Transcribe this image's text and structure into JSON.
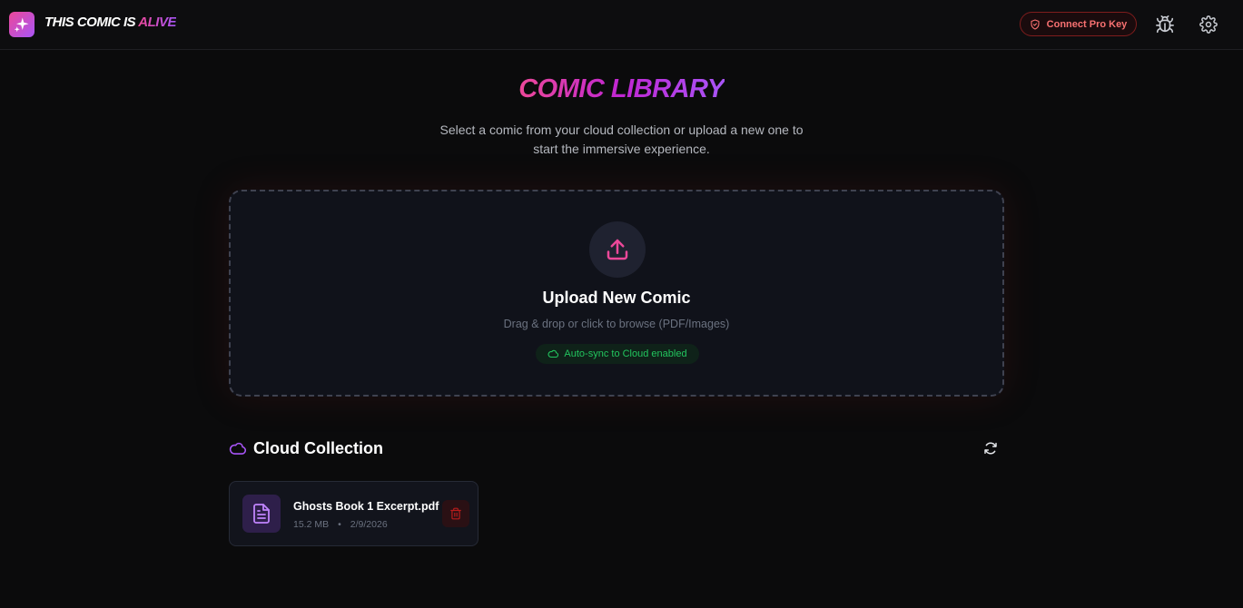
{
  "header": {
    "brand_main": "This Comic Is ",
    "brand_accent": "Alive",
    "pro_key_label": "Connect Pro Key"
  },
  "page": {
    "title": "Comic Library",
    "subtitle": "Select a comic from your cloud collection or upload a new one to start the immersive experience."
  },
  "upload": {
    "title": "Upload New Comic",
    "hint": "Drag & drop or click to browse (PDF/Images)",
    "sync_label": "Auto-sync to Cloud enabled"
  },
  "collection": {
    "title": "Cloud Collection",
    "files": [
      {
        "name": "Ghosts Book 1 Excerpt.pdf",
        "size": "15.2 MB",
        "separator": "•",
        "date": "2/9/2026"
      }
    ]
  },
  "icons": {
    "logo": "sparkles-icon",
    "pro_key": "shield-icon",
    "debug": "bug-icon",
    "settings": "gear-icon",
    "upload": "upload-icon",
    "sync": "cloud-icon",
    "collection": "cloud-icon",
    "refresh": "refresh-icon",
    "file": "file-text-icon",
    "delete": "trash-icon"
  },
  "colors": {
    "accent_pink": "#ec4899",
    "accent_purple": "#a855f7",
    "danger": "#f87171",
    "success": "#22c55e",
    "background": "#0b0b0c"
  }
}
